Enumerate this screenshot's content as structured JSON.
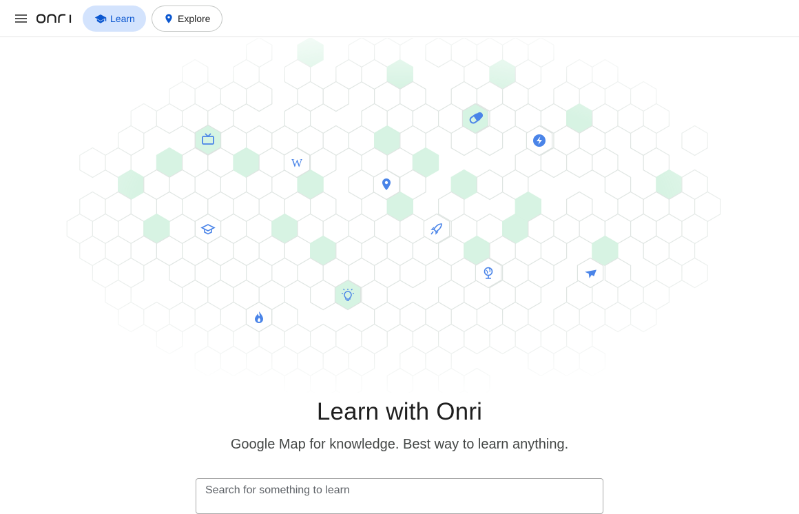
{
  "header": {
    "logo_text": "onri",
    "nav": [
      {
        "label": "Learn",
        "icon": "graduation-cap-icon",
        "active": true
      },
      {
        "label": "Explore",
        "icon": "location-pin-icon",
        "active": false
      }
    ]
  },
  "hero": {
    "icons": [
      "tv-icon",
      "wikipedia-icon",
      "location-pin-icon",
      "pill-icon",
      "lightning-icon",
      "graduation-cap-icon",
      "rocket-icon",
      "globe-icon",
      "airplane-icon",
      "lightbulb-icon",
      "fire-icon"
    ]
  },
  "main": {
    "title": "Learn with Onri",
    "subtitle": "Google Map for knowledge. Best way to learn anything.",
    "search_placeholder": "Search for something to learn"
  },
  "colors": {
    "accent": "#0b57d0",
    "active_pill_bg": "#d3e3fd",
    "icon_blue": "#4a84e8",
    "hex_green": "#c9efd9",
    "hex_stroke": "#dfe5e2"
  }
}
